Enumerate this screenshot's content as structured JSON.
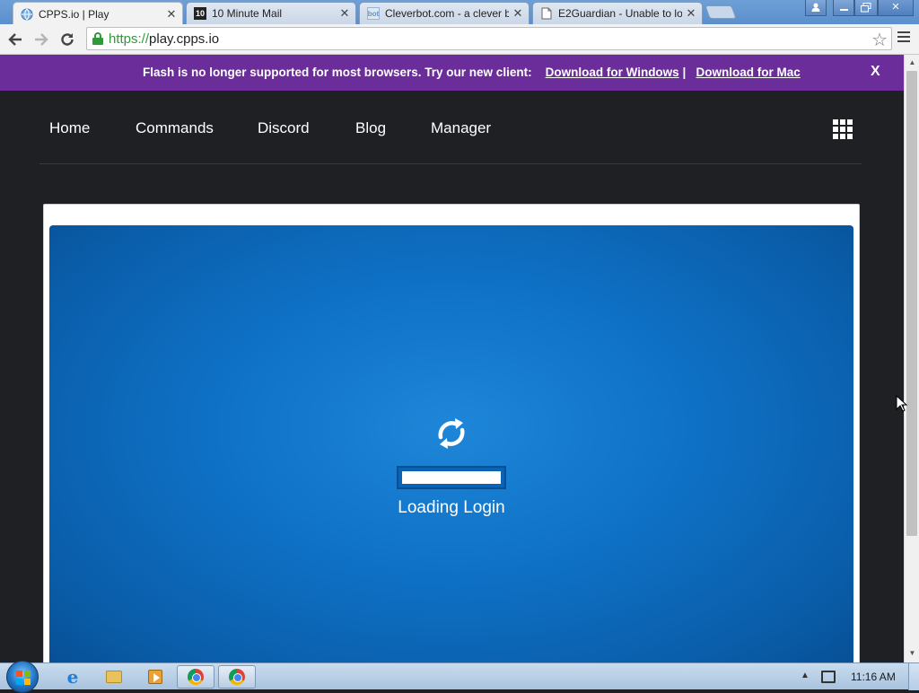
{
  "browser": {
    "tabs": [
      {
        "title": "CPPS.io | Play",
        "favicon": "globe-favicon",
        "active": true
      },
      {
        "title": "10 Minute Mail",
        "favicon": "ten-favicon",
        "favicon_text": "10",
        "active": false
      },
      {
        "title": "Cleverbot.com - a clever b",
        "favicon": "bot-favicon",
        "favicon_text": "bot",
        "active": false
      },
      {
        "title": "E2Guardian - Unable to lo",
        "favicon": "page-favicon",
        "active": false
      }
    ],
    "url_scheme": "https://",
    "url_host": "play.cpps.io"
  },
  "banner": {
    "message": "Flash is no longer supported for most browsers. Try our new client:",
    "link_windows": "Download for Windows",
    "separator": "|",
    "link_mac": "Download for Mac",
    "close_label": "X",
    "color": "#6a2d9a"
  },
  "site_nav": {
    "items": [
      {
        "label": "Home"
      },
      {
        "label": "Commands"
      },
      {
        "label": "Discord"
      },
      {
        "label": "Blog"
      },
      {
        "label": "Manager"
      }
    ],
    "apps_icon": "grid-icon"
  },
  "game": {
    "loading_text": "Loading Login",
    "progress": 1.0,
    "icon": "refresh-icon",
    "bg_color": "#0f72c7"
  },
  "taskbar": {
    "clock": "11:16 AM",
    "pinned": [
      "ie-icon",
      "folder-icon",
      "media-player-icon",
      "chrome-icon",
      "chrome-icon"
    ]
  }
}
